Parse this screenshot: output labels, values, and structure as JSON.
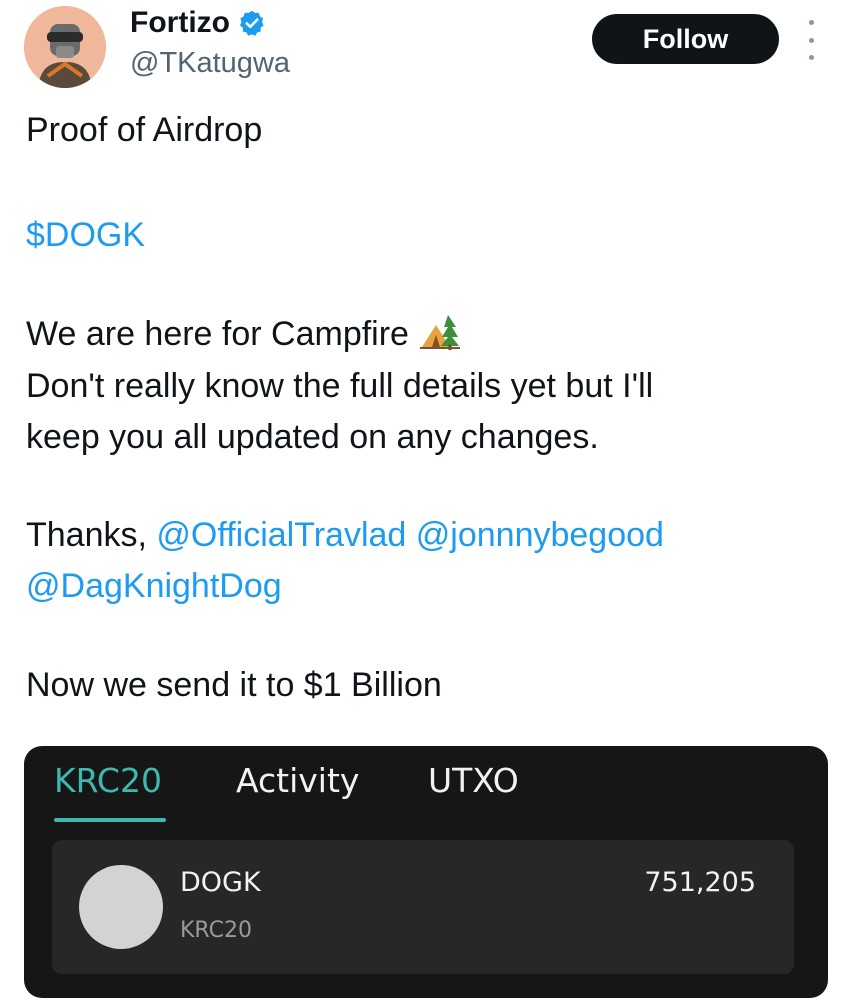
{
  "author": {
    "display_name": "Fortizo",
    "handle": "@TKatugwa",
    "verified": true
  },
  "follow_label": "Follow",
  "tweet": {
    "line1": "Proof of Airdrop",
    "line2": "$DOGK",
    "line3": "We are here for Campfire",
    "line4": "Don't really know the full details yet but I'll",
    "line5": "keep you all updated on any changes.",
    "thanks": "Thanks,",
    "mention1": "@OfficialTravlad",
    "mention2": "@jonnnybegood",
    "mention3": "@DagKnightDog",
    "line_last": "Now we send it to $1 Billion"
  },
  "wallet": {
    "tabs": [
      "KRC20",
      "Activity",
      "UTXO"
    ],
    "active_tab": "KRC20",
    "token": {
      "name": "DOGK",
      "standard": "KRC20",
      "balance": "751,205"
    }
  },
  "colors": {
    "accent": "#1d9bf0",
    "verified": "#1d9bf0",
    "wallet_active_tab": "#3fb8b0",
    "wallet_bg": "#161616"
  },
  "icons": [
    "verified-badge-icon",
    "more-options-icon",
    "campfire-emoji-icon",
    "token-icon"
  ]
}
